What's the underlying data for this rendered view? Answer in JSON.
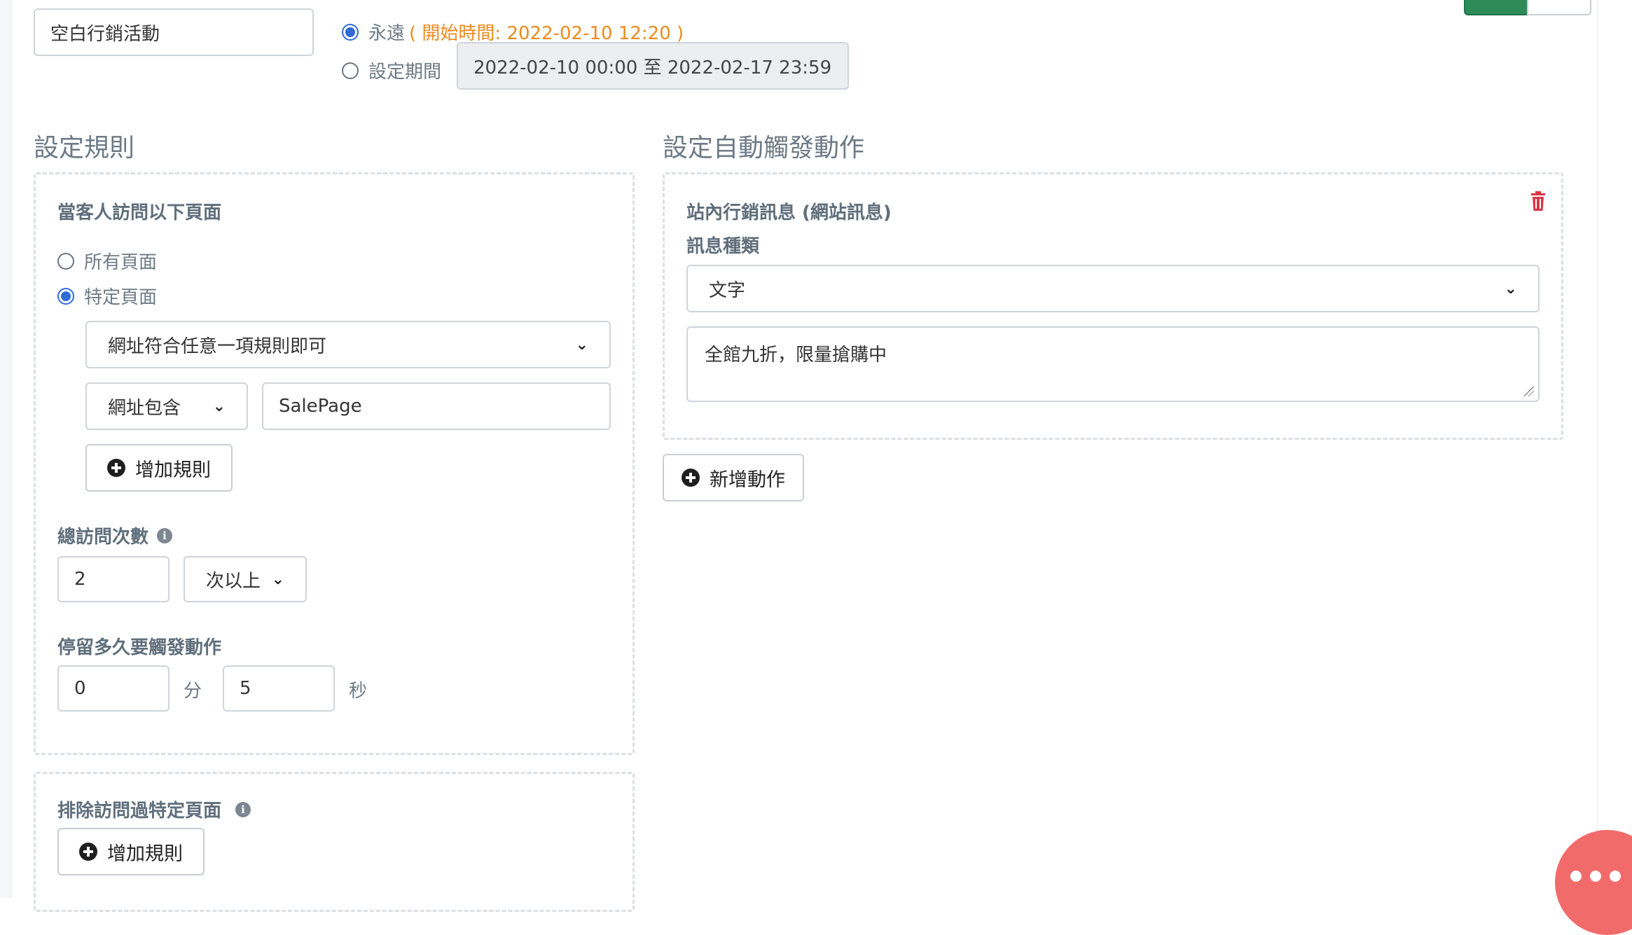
{
  "campaign": {
    "name_value": "空白行銷活動",
    "forever_label": "永遠",
    "start_time_text": "( 開始時間: 2022-02-10 12:20 )",
    "set_period_label": "設定期間",
    "period_value": "2022-02-10 00:00 至 2022-02-17 23:59"
  },
  "rules": {
    "title": "設定規則",
    "visit_pages": {
      "label": "當客人訪問以下頁面",
      "all_pages_label": "所有頁面",
      "specific_pages_label": "特定頁面",
      "match_mode": "網址符合任意一項規則即可",
      "condition_type": "網址包含",
      "condition_value": "SalePage",
      "add_rule_label": "增加規則"
    },
    "total_visits": {
      "label": "總訪問次數",
      "value": "2",
      "qualifier": "次以上"
    },
    "stay_duration": {
      "label": "停留多久要觸發動作",
      "minutes_value": "0",
      "minutes_unit": "分",
      "seconds_value": "5",
      "seconds_unit": "秒"
    },
    "exclude": {
      "label": "排除訪問過特定頁面",
      "add_rule_label": "增加規則"
    }
  },
  "actions": {
    "title": "設定自動觸發動作",
    "card": {
      "title": "站內行銷訊息 (網站訊息)",
      "type_label": "訊息種類",
      "type_value": "文字",
      "message_value": "全館九折，限量搶購中"
    },
    "add_action_label": "新增動作"
  },
  "colors": {
    "accent_blue": "#2e6bd9",
    "orange": "#ec8b1e",
    "danger_red": "#dc3545",
    "save_green": "#2f8a5a",
    "chat_bubble": "#f26b6b"
  },
  "icons": {
    "info": "info-circle-icon",
    "trash": "trash-icon",
    "plus": "plus-circle-icon",
    "chevron": "chevron-down-icon",
    "chat": "chat-bubble-icon"
  }
}
